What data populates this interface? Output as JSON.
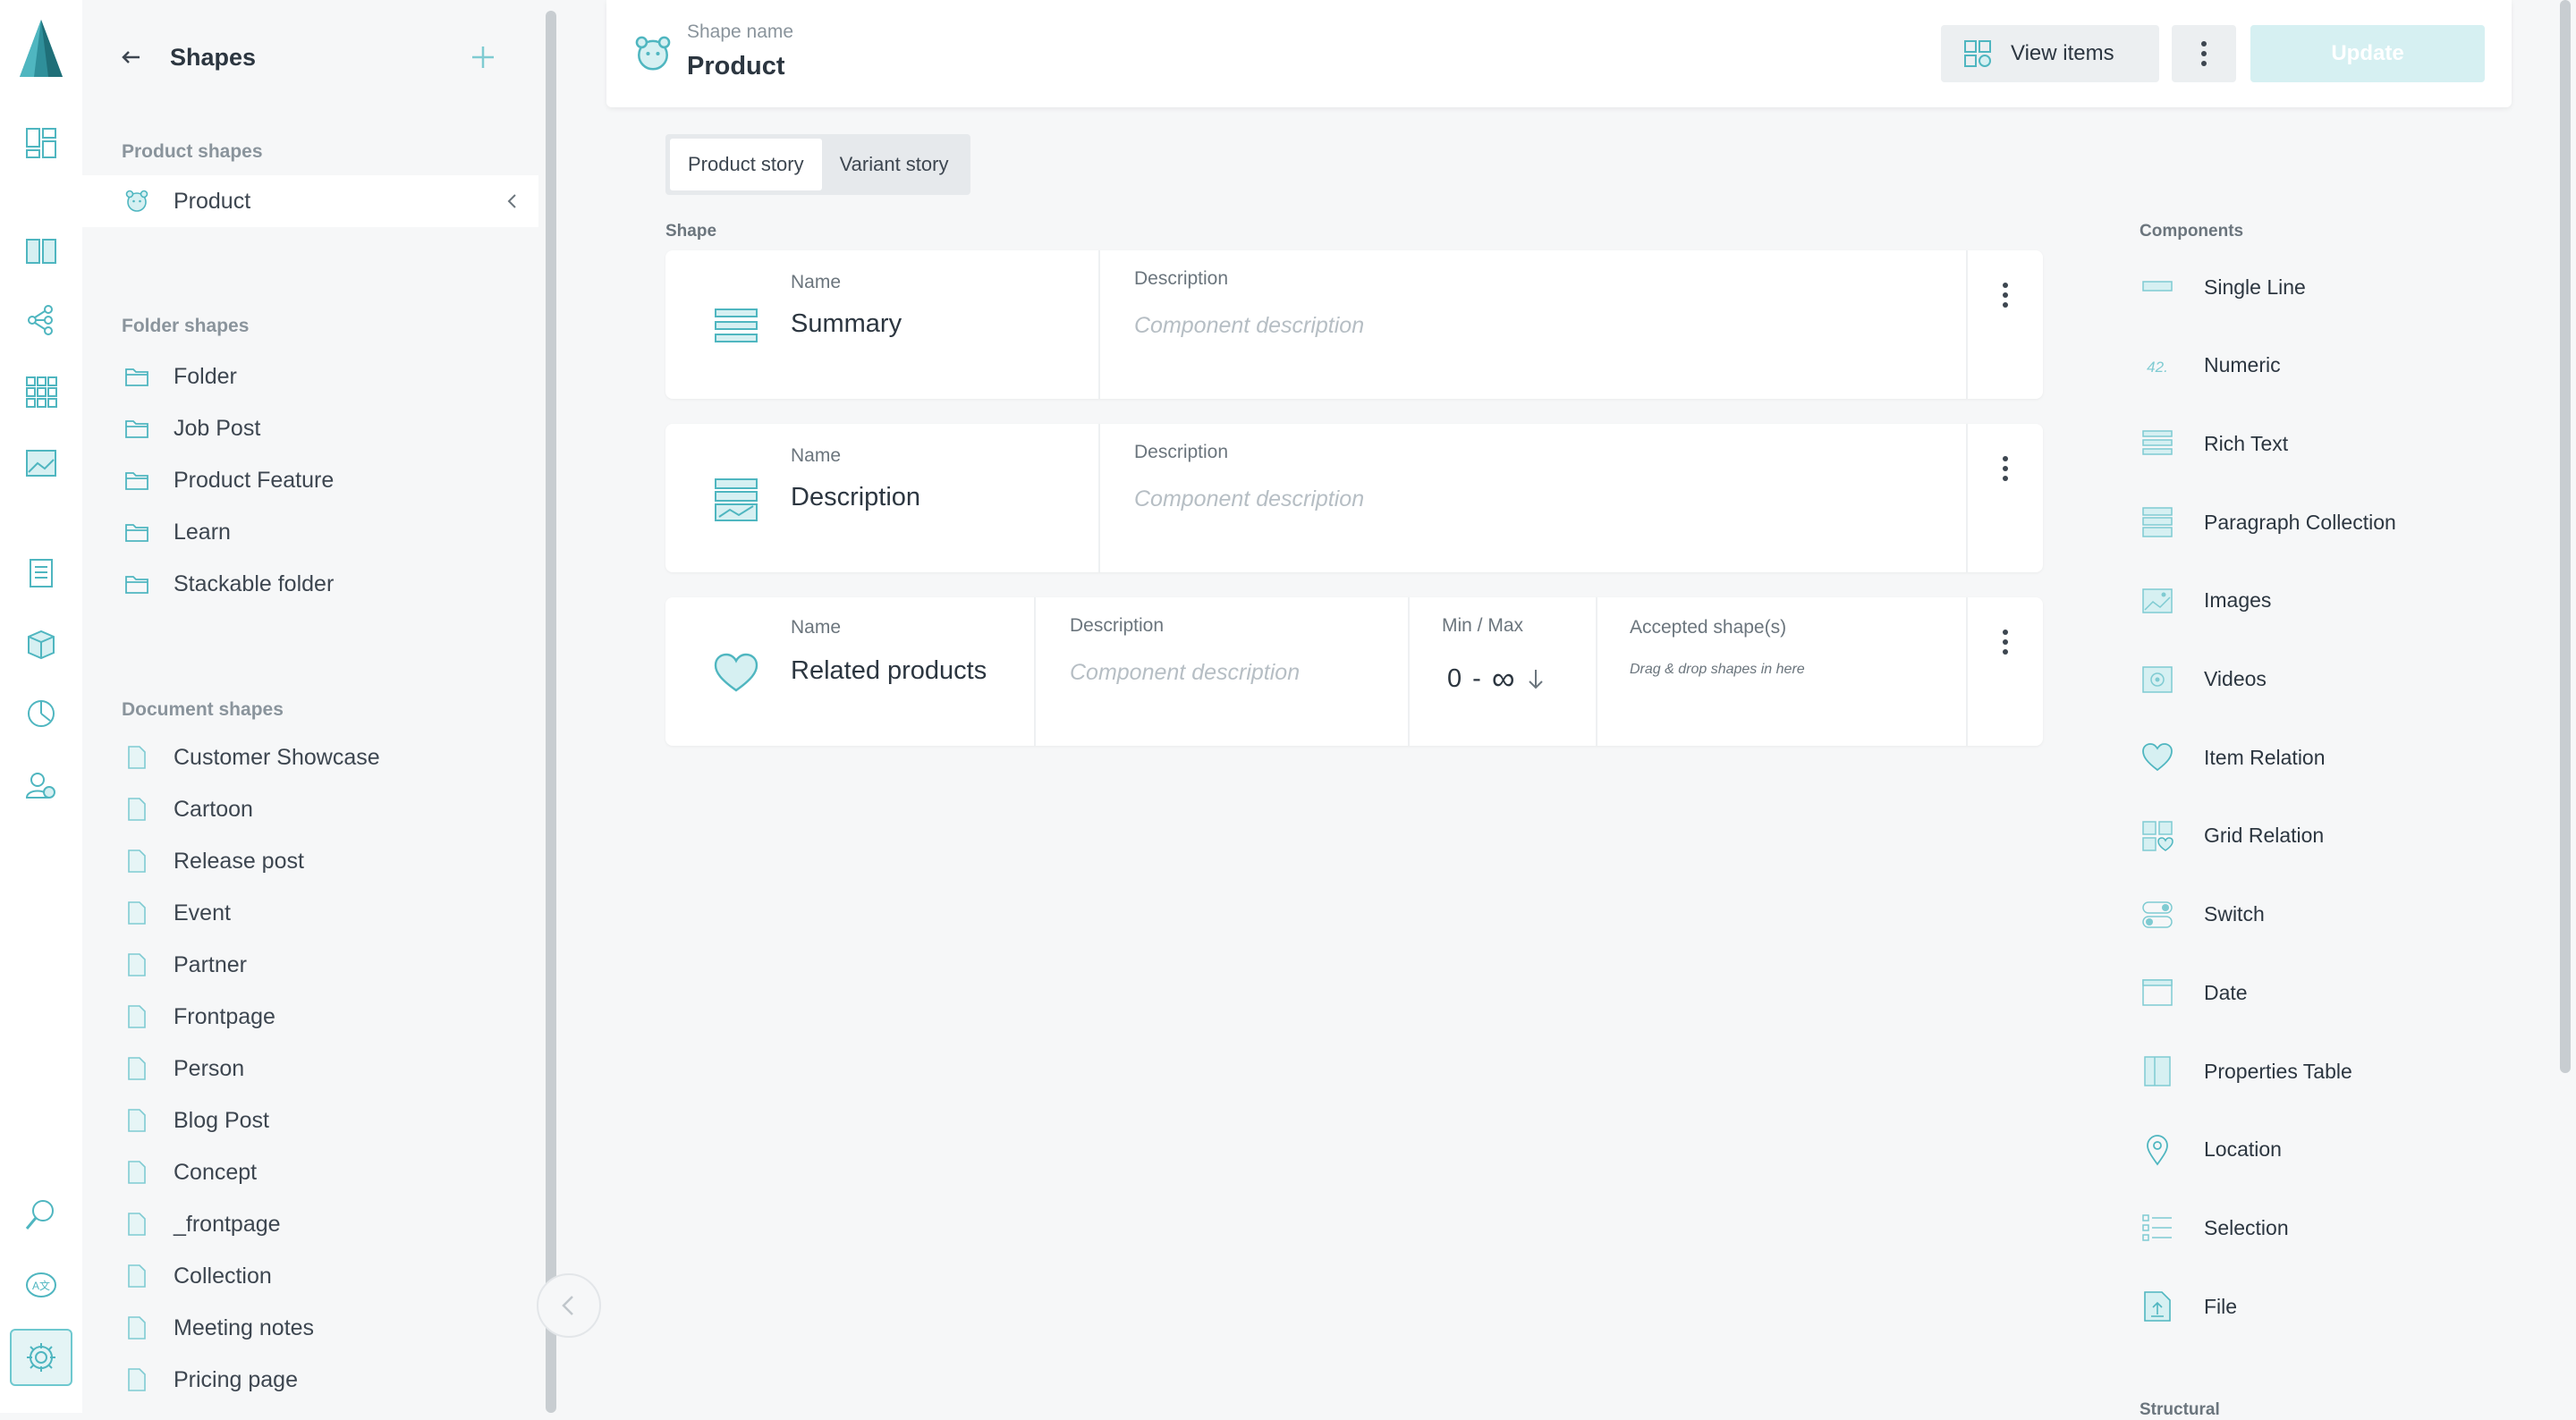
{
  "header": {
    "shape_name_label": "Shape name",
    "shape_name": "Product",
    "view_items_label": "View items",
    "update_label": "Update"
  },
  "sidebar": {
    "title": "Shapes",
    "product_section": "Product shapes",
    "product_items": [
      "Product"
    ],
    "folder_section": "Folder shapes",
    "folder_items": [
      "Folder",
      "Job Post",
      "Product Feature",
      "Learn",
      "Stackable folder"
    ],
    "document_section": "Document shapes",
    "document_items": [
      "Customer Showcase",
      "Cartoon",
      "Release post",
      "Event",
      "Partner",
      "Frontpage",
      "Person",
      "Blog Post",
      "Concept",
      "_frontpage",
      "Collection",
      "Meeting notes",
      "Pricing page"
    ]
  },
  "tabs": [
    "Product story",
    "Variant story"
  ],
  "shape_label": "Shape",
  "cards": {
    "summary": {
      "name_label": "Name",
      "name": "Summary",
      "desc_label": "Description",
      "desc_placeholder": "Component description"
    },
    "description": {
      "name_label": "Name",
      "name": "Description",
      "desc_label": "Description",
      "desc_placeholder": "Component description"
    },
    "related": {
      "name_label": "Name",
      "name": "Related products",
      "desc_label": "Description",
      "desc_placeholder": "Component description",
      "minmax_label": "Min / Max",
      "min": "0",
      "dash": "-",
      "max": "∞",
      "accepted_label": "Accepted shape(s)",
      "accepted_hint": "Drag & drop shapes in here"
    }
  },
  "components": {
    "heading": "Components",
    "items": [
      {
        "label": "Single Line",
        "icon": "single-line-icon"
      },
      {
        "label": "Numeric",
        "icon": "numeric-icon"
      },
      {
        "label": "Rich Text",
        "icon": "rich-text-icon"
      },
      {
        "label": "Paragraph Collection",
        "icon": "paragraph-collection-icon"
      },
      {
        "label": "Images",
        "icon": "images-icon"
      },
      {
        "label": "Videos",
        "icon": "videos-icon"
      },
      {
        "label": "Item Relation",
        "icon": "heart-icon"
      },
      {
        "label": "Grid Relation",
        "icon": "grid-relation-icon"
      },
      {
        "label": "Switch",
        "icon": "switch-icon"
      },
      {
        "label": "Date",
        "icon": "date-icon"
      },
      {
        "label": "Properties Table",
        "icon": "properties-table-icon"
      },
      {
        "label": "Location",
        "icon": "location-icon"
      },
      {
        "label": "Selection",
        "icon": "selection-icon"
      },
      {
        "label": "File",
        "icon": "file-icon"
      }
    ],
    "structural_heading": "Structural"
  },
  "colors": {
    "accent": "#4fb6c0",
    "accent_light": "#d6f0f2",
    "text": "#2c3640"
  }
}
